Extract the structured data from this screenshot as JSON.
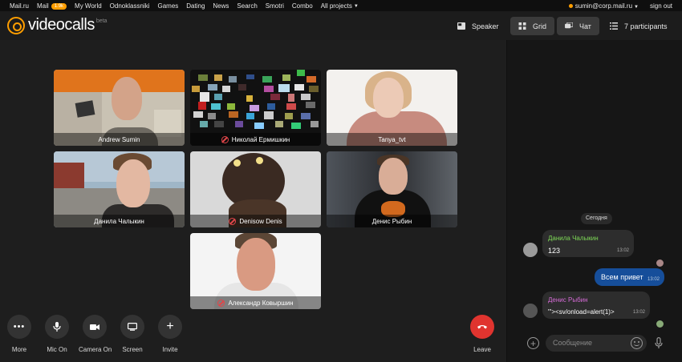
{
  "portal": {
    "links": [
      "Mail.ru",
      "Mail",
      "My World",
      "Odnoklassniki",
      "Games",
      "Dating",
      "News",
      "Search",
      "Smotri",
      "Combo",
      "All projects"
    ],
    "mail_badge": "1.9k",
    "user": "sumin@corp.mail.ru",
    "signout": "sign out"
  },
  "header": {
    "logo": "videocalls",
    "beta": "beta",
    "speaker_label": "Speaker",
    "grid_label": "Grid",
    "chat_label": "Чат",
    "participants_label": "7 participants"
  },
  "tiles": [
    {
      "name": "Andrew Sumin",
      "cam_off": false
    },
    {
      "name": "Николай Ермишкин",
      "cam_off": true
    },
    {
      "name": "Tanya_tvt",
      "cam_off": false
    },
    {
      "name": "Данила Чалыкин",
      "cam_off": false
    },
    {
      "name": "Denisow Denis",
      "cam_off": true
    },
    {
      "name": "Денис Рыбин",
      "cam_off": false
    },
    {
      "name": "Александр Ковыршин",
      "cam_off": true
    }
  ],
  "controls": {
    "more": "More",
    "mic": "Mic On",
    "camera": "Camera On",
    "screen": "Screen",
    "invite": "Invite",
    "leave": "Leave"
  },
  "chat": {
    "day": "Сегодня",
    "messages": [
      {
        "author": "Данила Чалыкин",
        "author_color": "#7ed957",
        "text": "123",
        "time": "13:02"
      },
      {
        "author": "",
        "text": "Всем привет",
        "time": "13:02"
      },
      {
        "author": "Денис Рыбин",
        "author_color": "#d56bd6",
        "text": "\"'><sv/onload=alert(1)>",
        "time": "13:02"
      }
    ],
    "input_placeholder": "Сообщение"
  },
  "colors": {
    "accent": "#ff9e00",
    "leave": "#e0342f",
    "outgoing": "#164e9a"
  }
}
